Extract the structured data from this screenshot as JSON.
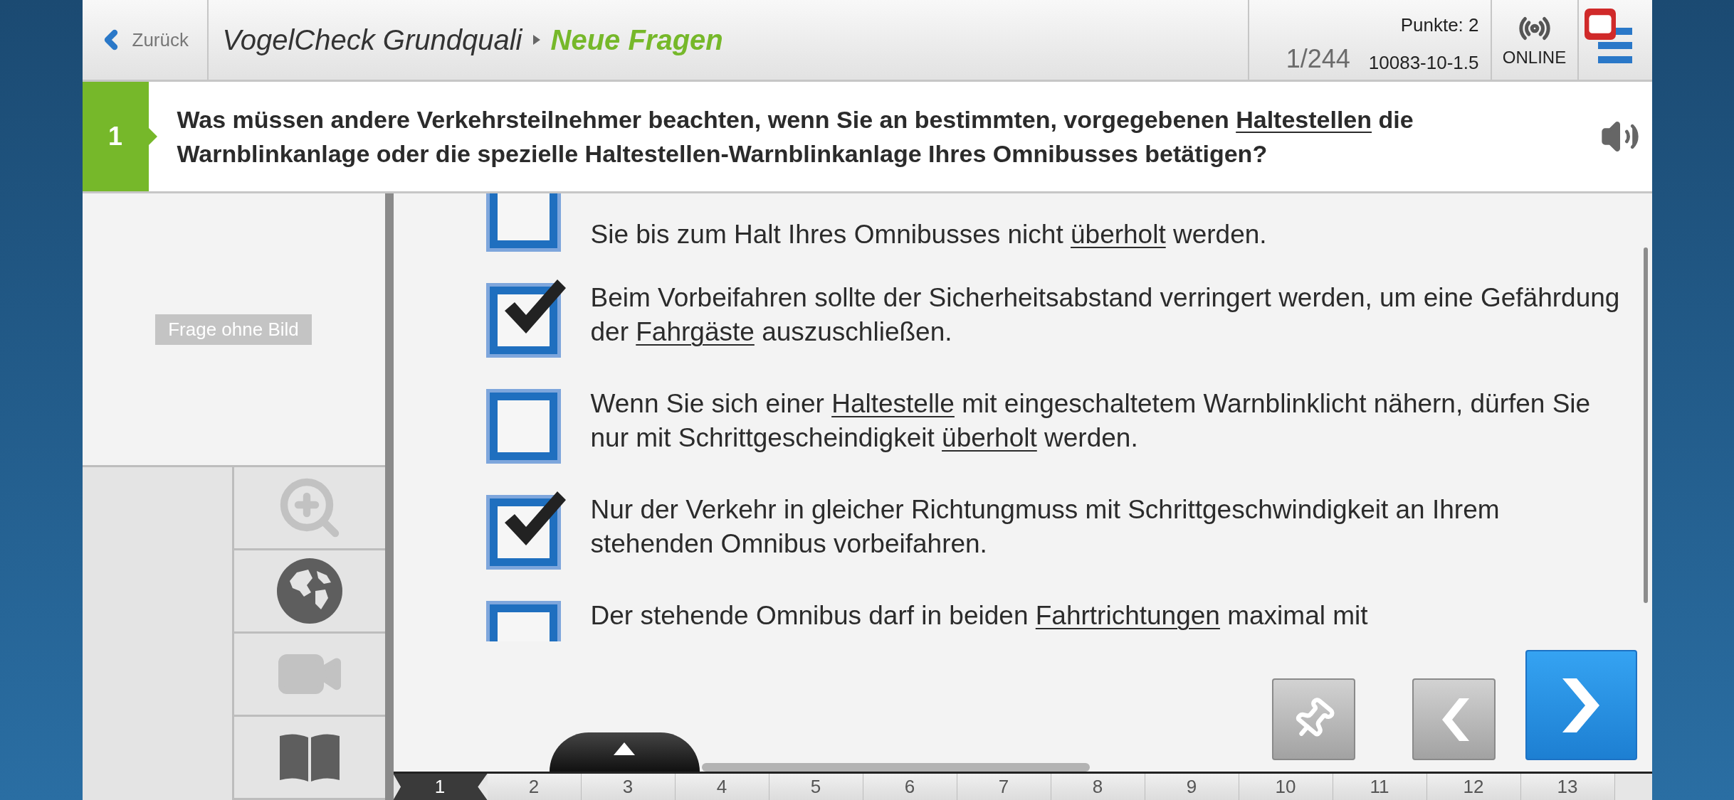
{
  "header": {
    "back_label": "Zurück",
    "breadcrumb": [
      {
        "label": "VogelCheck Grundquali",
        "current": false
      },
      {
        "label": "Neue Fragen",
        "current": true
      }
    ],
    "points": "Punkte: 2",
    "progress": "1/244",
    "question_id": "10083-10-1.5",
    "connection": "ONLINE"
  },
  "question": {
    "number": "1",
    "segments": [
      {
        "text": "Was müssen andere Verkehrsteilnehmer beachten, wenn Sie an bestimmten, vorgegebenen ",
        "kind": "text"
      },
      {
        "text": "Haltestellen",
        "kind": "link"
      },
      {
        "text": " die Warnblinkanlage oder die spezielle Haltestellen-Warnblinkanlage Ihres Omnibusses betätigen?",
        "kind": "text"
      }
    ]
  },
  "image_placeholder": "Frage ohne Bild",
  "tools": [
    {
      "kind": "zoom",
      "disabled": true
    },
    {
      "kind": "globe",
      "disabled": false
    },
    {
      "kind": "video",
      "disabled": true
    },
    {
      "kind": "book",
      "disabled": false
    }
  ],
  "answers": [
    {
      "checked": false,
      "segments": [
        {
          "text": "Sie bis zum Halt Ihres Omnibusses nicht ",
          "kind": "text"
        },
        {
          "text": "überholt",
          "kind": "link"
        },
        {
          "text": " werden.",
          "kind": "text"
        }
      ]
    },
    {
      "checked": true,
      "segments": [
        {
          "text": "Beim Vorbeifahren sollte der Sicherheitsabstand verringert werden, um eine Gefährdung der ",
          "kind": "text"
        },
        {
          "text": "Fahrgäste",
          "kind": "link"
        },
        {
          "text": " auszuschließen.",
          "kind": "text"
        }
      ]
    },
    {
      "checked": false,
      "segments": [
        {
          "text": "Wenn Sie sich einer ",
          "kind": "text"
        },
        {
          "text": "Haltestelle",
          "kind": "link"
        },
        {
          "text": " mit eingeschaltetem Warnblinklicht nähern, dürfen Sie nur mit Schrittgescheindigkeit ",
          "kind": "text"
        },
        {
          "text": "überholt",
          "kind": "link"
        },
        {
          "text": " werden.",
          "kind": "text"
        }
      ]
    },
    {
      "checked": true,
      "segments": [
        {
          "text": "Nur der Verkehr in gleicher Richtungmuss mit Schrittgeschwindigkeit an Ihrem stehenden Omnibus vorbeifahren.",
          "kind": "text"
        }
      ]
    },
    {
      "checked": false,
      "segments": [
        {
          "text": "Der stehende Omnibus darf in beiden ",
          "kind": "text"
        },
        {
          "text": "Fahrtrichtungen",
          "kind": "link"
        },
        {
          "text": " maximal mit",
          "kind": "text"
        }
      ]
    }
  ],
  "nav_buttons": [
    {
      "kind": "pin",
      "primary": false
    },
    {
      "kind": "prev",
      "primary": false
    },
    {
      "kind": "next",
      "primary": true
    }
  ],
  "pager": [
    {
      "label": "1",
      "selected": true
    },
    {
      "label": "2",
      "selected": false
    },
    {
      "label": "3",
      "selected": false
    },
    {
      "label": "4",
      "selected": false
    },
    {
      "label": "5",
      "selected": false
    },
    {
      "label": "6",
      "selected": false
    },
    {
      "label": "7",
      "selected": false
    },
    {
      "label": "8",
      "selected": false
    },
    {
      "label": "9",
      "selected": false
    },
    {
      "label": "10",
      "selected": false
    },
    {
      "label": "11",
      "selected": false
    },
    {
      "label": "12",
      "selected": false
    },
    {
      "label": "13",
      "selected": false
    }
  ]
}
